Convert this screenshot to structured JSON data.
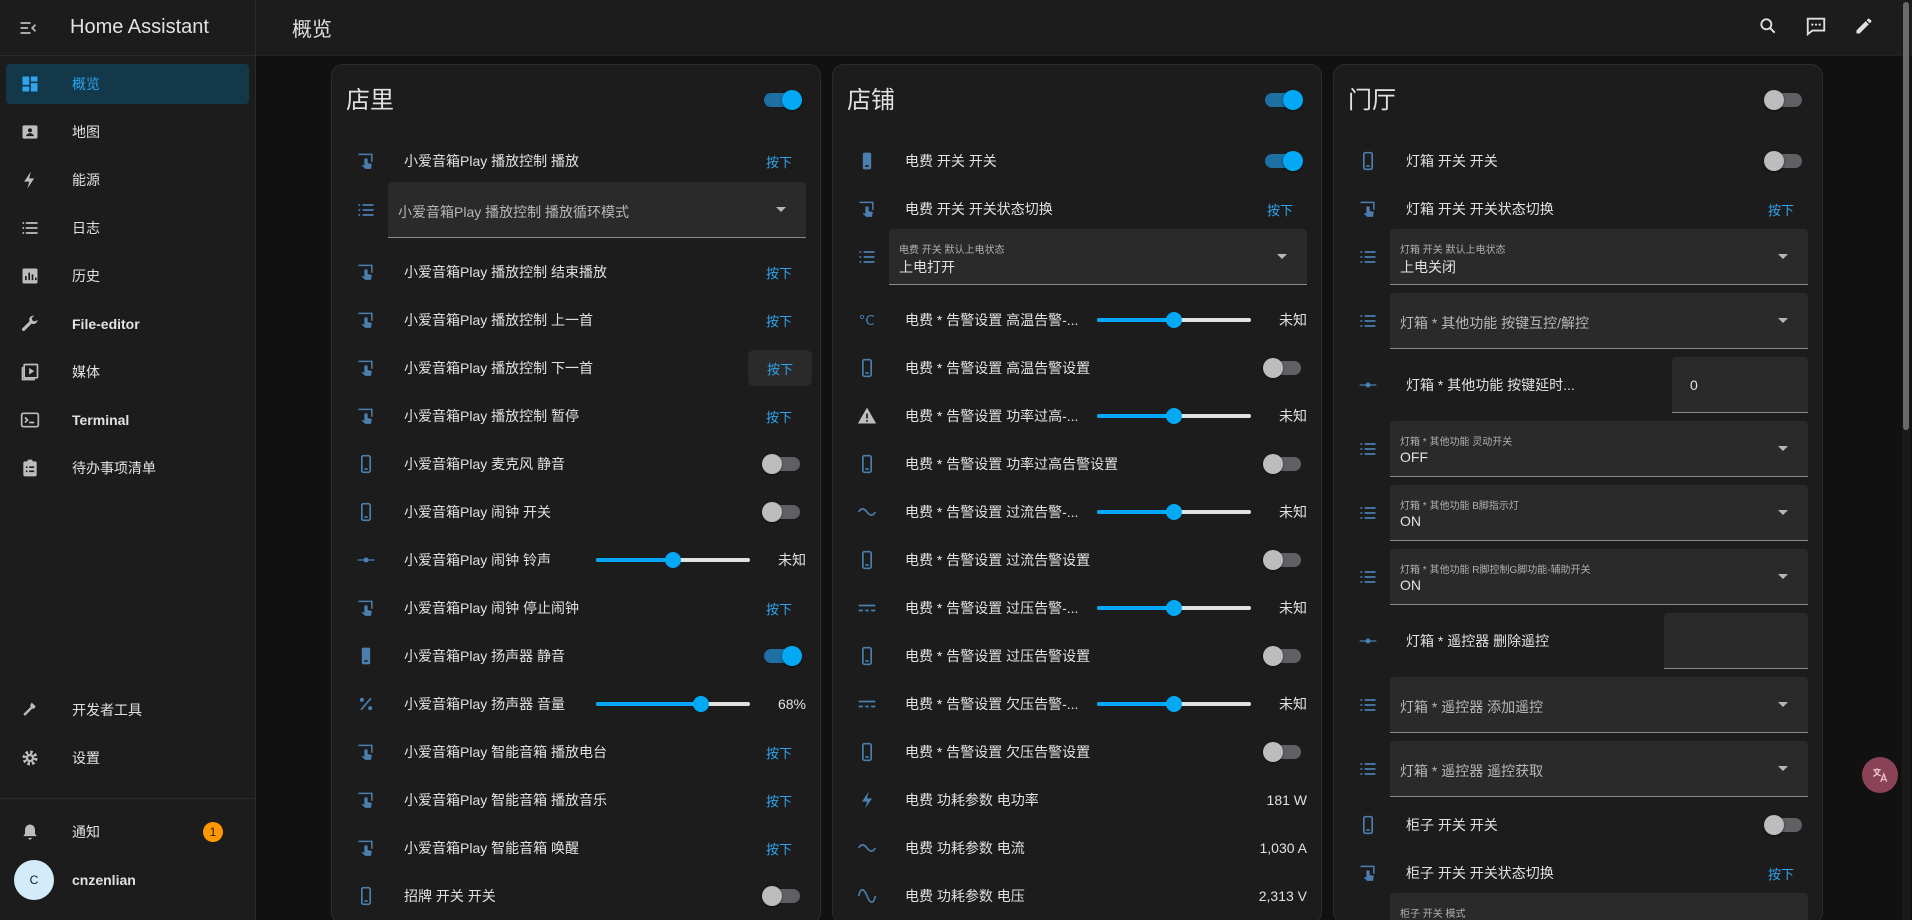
{
  "app": {
    "title": "Home Assistant"
  },
  "sidebar": {
    "items": [
      {
        "label": "概览",
        "icon": "dashboard-icon",
        "active": true
      },
      {
        "label": "地图",
        "icon": "map-icon"
      },
      {
        "label": "能源",
        "icon": "lightning-icon"
      },
      {
        "label": "日志",
        "icon": "logbook-icon"
      },
      {
        "label": "历史",
        "icon": "history-icon"
      },
      {
        "label": "File-editor",
        "icon": "wrench-icon"
      },
      {
        "label": "媒体",
        "icon": "media-icon"
      },
      {
        "label": "Terminal",
        "icon": "terminal-icon"
      },
      {
        "label": "待办事项清单",
        "icon": "todo-icon"
      }
    ],
    "developer_tools": "开发者工具",
    "settings": "设置",
    "notifications": "通知",
    "notifications_count": "1",
    "user_name": "cnzenlian",
    "user_initial": "C"
  },
  "header": {
    "title": "概览"
  },
  "colors": {
    "accent": "#03a9f4",
    "sidebar_active_bg": "#13384a",
    "badge": "#ff9800"
  },
  "card1": {
    "title": "店里",
    "master_on": true,
    "rows": [
      {
        "name": "小爱音箱Play 播放控制 播放",
        "action": "按下"
      },
      {
        "label": "小爱音箱Play 播放控制 播放循环模式"
      },
      {
        "name": "小爱音箱Play 播放控制 结束播放",
        "action": "按下"
      },
      {
        "name": "小爱音箱Play 播放控制 上一首",
        "action": "按下"
      },
      {
        "name": "小爱音箱Play 播放控制 下一首",
        "action": "按下"
      },
      {
        "name": "小爱音箱Play 播放控制 暂停",
        "action": "按下"
      },
      {
        "name": "小爱音箱Play 麦克风 静音",
        "on": false
      },
      {
        "name": "小爱音箱Play 闹钟 开关",
        "on": false
      },
      {
        "name": "小爱音箱Play 闹钟 铃声",
        "level": 0.5,
        "value": "未知"
      },
      {
        "name": "小爱音箱Play 闹钟 停止闹钟",
        "action": "按下"
      },
      {
        "name": "小爱音箱Play 扬声器 静音",
        "on": true
      },
      {
        "name": "小爱音箱Play 扬声器 音量",
        "level": 0.68,
        "value": "68%"
      },
      {
        "name": "小爱音箱Play 智能音箱 播放电台",
        "action": "按下"
      },
      {
        "name": "小爱音箱Play 智能音箱 播放音乐",
        "action": "按下"
      },
      {
        "name": "小爱音箱Play 智能音箱 唤醒",
        "action": "按下"
      },
      {
        "name": "招牌 开关 开关",
        "on": false
      }
    ]
  },
  "card2": {
    "title": "店铺",
    "master_on": true,
    "rows": [
      {
        "name": "电费 开关 开关",
        "on": true
      },
      {
        "name": "电费 开关 开关状态切换",
        "action": "按下"
      },
      {
        "label": "电费 开关 默认上电状态",
        "value": "上电打开"
      },
      {
        "name": "电费 * 告警设置 高温告警-...",
        "level": 0.5,
        "value": "未知"
      },
      {
        "name": "电费 * 告警设置 高温告警设置",
        "on": false
      },
      {
        "name": "电费 * 告警设置 功率过高-...",
        "level": 0.5,
        "value": "未知"
      },
      {
        "name": "电费 * 告警设置 功率过高告警设置",
        "on": false
      },
      {
        "name": "电费 * 告警设置 过流告警-...",
        "level": 0.5,
        "value": "未知"
      },
      {
        "name": "电费 * 告警设置 过流告警设置",
        "on": false
      },
      {
        "name": "电费 * 告警设置 过压告警-...",
        "level": 0.5,
        "value": "未知"
      },
      {
        "name": "电费 * 告警设置 过压告警设置",
        "on": false
      },
      {
        "name": "电费 * 告警设置 欠压告警-...",
        "level": 0.5,
        "value": "未知"
      },
      {
        "name": "电费 * 告警设置 欠压告警设置",
        "on": false
      },
      {
        "name": "电费 功耗参数 电功率",
        "value": "181 W"
      },
      {
        "name": "电费 功耗参数 电流",
        "value": "1,030 A"
      },
      {
        "name": "电费 功耗参数 电压",
        "value": "2,313 V"
      }
    ]
  },
  "card3": {
    "title": "门厅",
    "master_on": false,
    "rows": [
      {
        "name": "灯箱 开关 开关",
        "on": false
      },
      {
        "name": "灯箱 开关 开关状态切换",
        "action": "按下"
      },
      {
        "label": "灯箱 开关 默认上电状态",
        "value": "上电关闭"
      },
      {
        "label": "灯箱 * 其他功能 按键互控/解控"
      },
      {
        "name": "灯箱 * 其他功能 按键延时...",
        "value": "0"
      },
      {
        "label": "灯箱 * 其他功能 灵动开关",
        "value": "OFF"
      },
      {
        "label": "灯箱 * 其他功能 B脚指示灯",
        "value": "ON"
      },
      {
        "label": "灯箱 * 其他功能 R脚控制G脚功能-辅助开关",
        "value": "ON"
      },
      {
        "name": "灯箱 * 遥控器 删除遥控",
        "value": ""
      },
      {
        "label": "灯箱 * 遥控器 添加遥控"
      },
      {
        "label": "灯箱 * 遥控器 遥控获取"
      },
      {
        "name": "柜子 开关 开关",
        "on": false
      },
      {
        "name": "柜子 开关 开关状态切换",
        "action": "按下"
      },
      {
        "label": "柜子 开关 模式"
      }
    ]
  }
}
